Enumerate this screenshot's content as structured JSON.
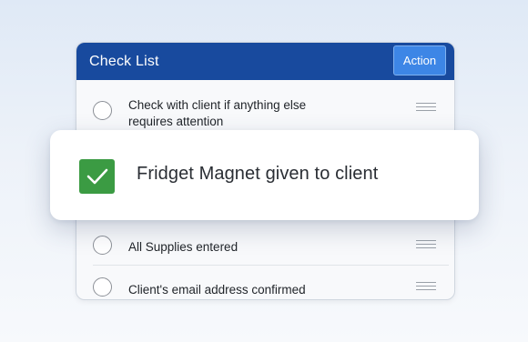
{
  "checklist": {
    "title": "Check List",
    "action_label": "Action",
    "items": [
      {
        "label_line1": "Check with client if anything else",
        "label_line2": "requires attention",
        "checked": false
      },
      {
        "label": "All Supplies entered",
        "checked": false
      },
      {
        "label": "Client's email address confirmed",
        "checked": false
      }
    ]
  },
  "popup": {
    "label": "Fridget Magnet given to client",
    "checked": true,
    "check_color": "#3b9b43"
  },
  "colors": {
    "header_bg": "#184a9e",
    "action_bg": "#3d86e6"
  },
  "icons": {
    "check": "check-icon",
    "drag": "drag-handle-icon"
  }
}
